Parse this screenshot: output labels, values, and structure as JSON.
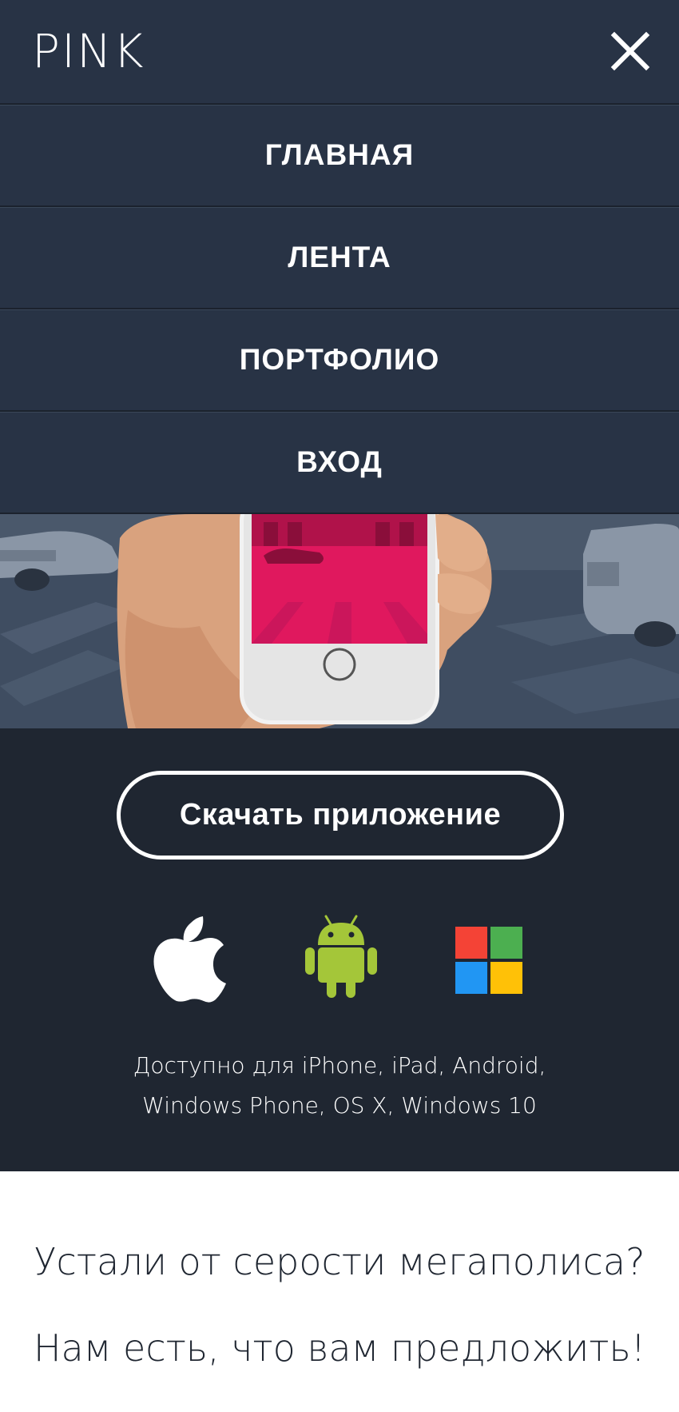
{
  "header": {
    "logo": "PINK",
    "close_icon": "close-icon"
  },
  "menu": {
    "items": [
      {
        "label": "ГЛАВНАЯ"
      },
      {
        "label": "ЛЕНТА"
      },
      {
        "label": "ПОРТФОЛИО"
      },
      {
        "label": "ВХОД"
      }
    ]
  },
  "download": {
    "button_label": "Скачать приложение",
    "platforms": [
      "apple-icon",
      "android-icon",
      "windows-icon"
    ],
    "availability_line1": "Доступно для iPhone, iPad, Android,",
    "availability_line2": "Windows Phone, OS X, Windows 10"
  },
  "slogan": {
    "line1": "Устали от серости мегаполиса?",
    "line2": "Нам есть, что вам предложить!"
  },
  "colors": {
    "header_bg": "#283345",
    "dark_bg": "#1f2631",
    "accent_pink": "#e0185e",
    "android_green": "#a4c639"
  }
}
